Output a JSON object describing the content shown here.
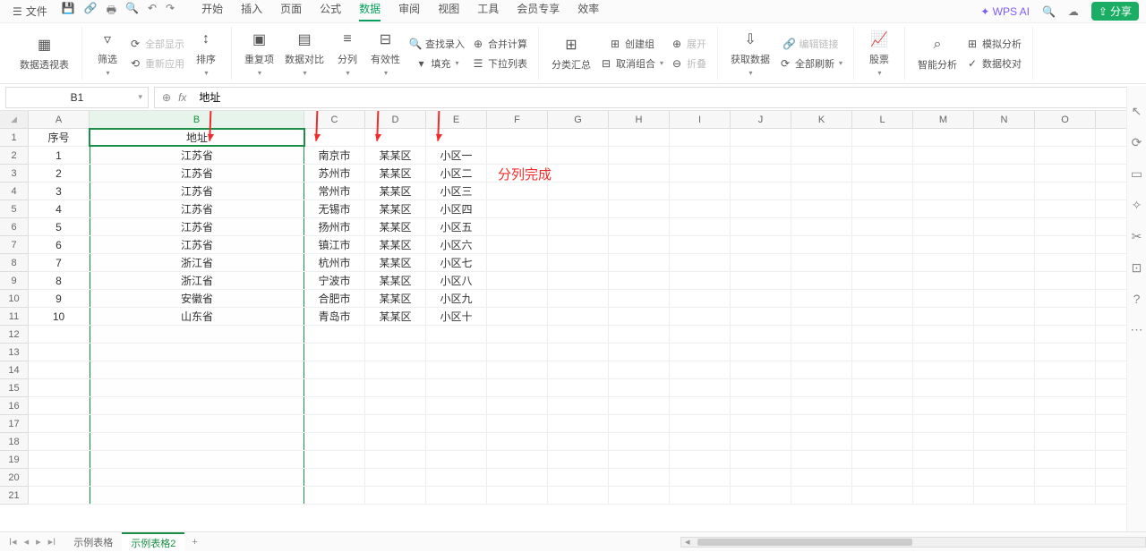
{
  "menu": {
    "file": "文件",
    "tabs": [
      "开始",
      "插入",
      "页面",
      "公式",
      "数据",
      "审阅",
      "视图",
      "工具",
      "会员专享",
      "效率"
    ],
    "active": 4,
    "ai": "WPS AI",
    "share": "分享"
  },
  "ribbon": {
    "pivot": "数据透视表",
    "filter": "筛选",
    "show_all": "全部显示",
    "reapply": "重新应用",
    "sort": "排序",
    "dedup": "重复项",
    "compare": "数据对比",
    "split": "分列",
    "validate": "有效性",
    "lookup": "查找录入",
    "merge": "合并计算",
    "fill": "填充",
    "dropdown": "下拉列表",
    "subtotal": "分类汇总",
    "group": "创建组",
    "ungroup": "取消组合",
    "expand": "展开",
    "collapse": "折叠",
    "import": "获取数据",
    "editlink": "编辑链接",
    "refresh": "全部刷新",
    "stocks": "股票",
    "smart": "智能分析",
    "sim": "模拟分析",
    "validate2": "数据校对"
  },
  "fx": {
    "cell": "B1",
    "value": "地址"
  },
  "cols": [
    "A",
    "B",
    "C",
    "D",
    "E",
    "F",
    "G",
    "H",
    "I",
    "J",
    "K",
    "L",
    "M",
    "N",
    "O"
  ],
  "rows": 21,
  "header_row": {
    "A": "序号",
    "B": "地址"
  },
  "table": [
    {
      "n": "1",
      "prov": "江苏省",
      "city": "南京市",
      "dist": "某某区",
      "comm": "小区一"
    },
    {
      "n": "2",
      "prov": "江苏省",
      "city": "苏州市",
      "dist": "某某区",
      "comm": "小区二"
    },
    {
      "n": "3",
      "prov": "江苏省",
      "city": "常州市",
      "dist": "某某区",
      "comm": "小区三"
    },
    {
      "n": "4",
      "prov": "江苏省",
      "city": "无锡市",
      "dist": "某某区",
      "comm": "小区四"
    },
    {
      "n": "5",
      "prov": "江苏省",
      "city": "扬州市",
      "dist": "某某区",
      "comm": "小区五"
    },
    {
      "n": "6",
      "prov": "江苏省",
      "city": "镇江市",
      "dist": "某某区",
      "comm": "小区六"
    },
    {
      "n": "7",
      "prov": "浙江省",
      "city": "杭州市",
      "dist": "某某区",
      "comm": "小区七"
    },
    {
      "n": "8",
      "prov": "浙江省",
      "city": "宁波市",
      "dist": "某某区",
      "comm": "小区八"
    },
    {
      "n": "9",
      "prov": "安徽省",
      "city": "合肥市",
      "dist": "某某区",
      "comm": "小区九"
    },
    {
      "n": "10",
      "prov": "山东省",
      "city": "青岛市",
      "dist": "某某区",
      "comm": "小区十"
    }
  ],
  "annotation": "分列完成",
  "sheets": {
    "s1": "示例表格",
    "s2": "示例表格2",
    "active": 1
  }
}
